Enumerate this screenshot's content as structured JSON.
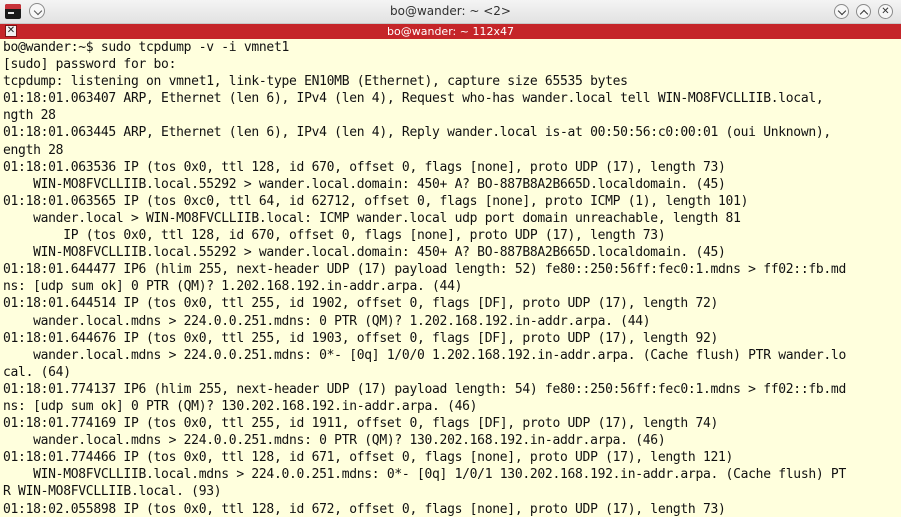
{
  "window": {
    "title": "bo@wander: ~ <2>",
    "minimize_label": "",
    "maximize_label": "",
    "close_label": "✕"
  },
  "tab": {
    "title": "bo@wander: ~ 112x47",
    "close_label": "✕"
  },
  "terminal": {
    "lines": [
      "bo@wander:~$ sudo tcpdump -v -i vmnet1",
      "[sudo] password for bo:",
      "tcpdump: listening on vmnet1, link-type EN10MB (Ethernet), capture size 65535 bytes",
      "01:18:01.063407 ARP, Ethernet (len 6), IPv4 (len 4), Request who-has wander.local tell WIN-MO8FVCLLIIB.local,",
      "ngth 28",
      "01:18:01.063445 ARP, Ethernet (len 6), IPv4 (len 4), Reply wander.local is-at 00:50:56:c0:00:01 (oui Unknown),",
      "ength 28",
      "01:18:01.063536 IP (tos 0x0, ttl 128, id 670, offset 0, flags [none], proto UDP (17), length 73)",
      "    WIN-MO8FVCLLIIB.local.55292 > wander.local.domain: 450+ A? BO-887B8A2B665D.localdomain. (45)",
      "01:18:01.063565 IP (tos 0xc0, ttl 64, id 62712, offset 0, flags [none], proto ICMP (1), length 101)",
      "    wander.local > WIN-MO8FVCLLIIB.local: ICMP wander.local udp port domain unreachable, length 81",
      "        IP (tos 0x0, ttl 128, id 670, offset 0, flags [none], proto UDP (17), length 73)",
      "    WIN-MO8FVCLLIIB.local.55292 > wander.local.domain: 450+ A? BO-887B8A2B665D.localdomain. (45)",
      "01:18:01.644477 IP6 (hlim 255, next-header UDP (17) payload length: 52) fe80::250:56ff:fec0:1.mdns > ff02::fb.md",
      "ns: [udp sum ok] 0 PTR (QM)? 1.202.168.192.in-addr.arpa. (44)",
      "01:18:01.644514 IP (tos 0x0, ttl 255, id 1902, offset 0, flags [DF], proto UDP (17), length 72)",
      "    wander.local.mdns > 224.0.0.251.mdns: 0 PTR (QM)? 1.202.168.192.in-addr.arpa. (44)",
      "01:18:01.644676 IP (tos 0x0, ttl 255, id 1903, offset 0, flags [DF], proto UDP (17), length 92)",
      "    wander.local.mdns > 224.0.0.251.mdns: 0*- [0q] 1/0/0 1.202.168.192.in-addr.arpa. (Cache flush) PTR wander.lo",
      "cal. (64)",
      "01:18:01.774137 IP6 (hlim 255, next-header UDP (17) payload length: 54) fe80::250:56ff:fec0:1.mdns > ff02::fb.md",
      "ns: [udp sum ok] 0 PTR (QM)? 130.202.168.192.in-addr.arpa. (46)",
      "01:18:01.774169 IP (tos 0x0, ttl 255, id 1911, offset 0, flags [DF], proto UDP (17), length 74)",
      "    wander.local.mdns > 224.0.0.251.mdns: 0 PTR (QM)? 130.202.168.192.in-addr.arpa. (46)",
      "01:18:01.774466 IP (tos 0x0, ttl 128, id 671, offset 0, flags [none], proto UDP (17), length 121)",
      "    WIN-MO8FVCLLIIB.local.mdns > 224.0.0.251.mdns: 0*- [0q] 1/0/1 130.202.168.192.in-addr.arpa. (Cache flush) PT",
      "R WIN-MO8FVCLLIIB.local. (93)",
      "01:18:02.055898 IP (tos 0x0, ttl 128, id 672, offset 0, flags [none], proto UDP (17), length 73)"
    ]
  },
  "colors": {
    "terminal_background": "#ffffdd",
    "tab_bar": "#c52529",
    "text": "#111111"
  }
}
